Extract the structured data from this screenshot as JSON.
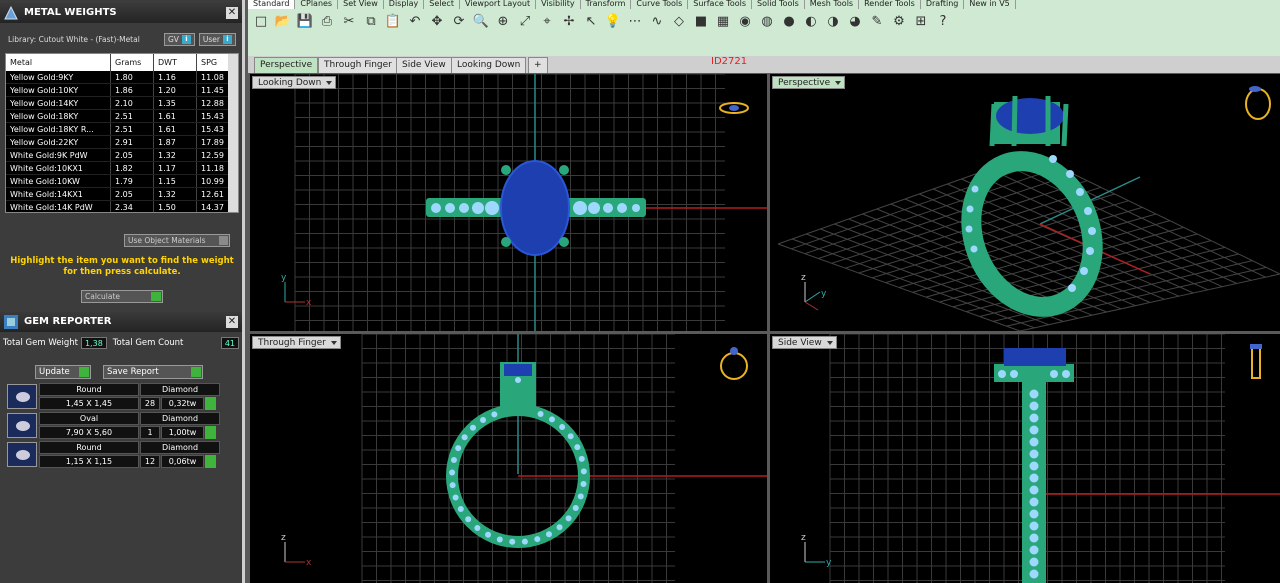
{
  "metal_panel": {
    "title": "METAL WEIGHTS",
    "library_label": "Library: Cutout White - (Fast)-Metal",
    "btn_gv": "GV",
    "btn_user": "User",
    "columns": [
      "Metal",
      "Grams",
      "DWT",
      "SPG"
    ],
    "rows": [
      [
        "Yellow Gold:9KY",
        "1.80",
        "1.16",
        "11.08"
      ],
      [
        "Yellow Gold:10KY",
        "1.86",
        "1.20",
        "11.45"
      ],
      [
        "Yellow Gold:14KY",
        "2.10",
        "1.35",
        "12.88"
      ],
      [
        "Yellow Gold:18KY",
        "2.51",
        "1.61",
        "15.43"
      ],
      [
        "Yellow Gold:18KY R...",
        "2.51",
        "1.61",
        "15.43"
      ],
      [
        "Yellow Gold:22KY",
        "2.91",
        "1.87",
        "17.89"
      ],
      [
        "White Gold:9K PdW",
        "2.05",
        "1.32",
        "12.59"
      ],
      [
        "White Gold:10KX1",
        "1.82",
        "1.17",
        "11.18"
      ],
      [
        "White Gold:10KW",
        "1.79",
        "1.15",
        "10.99"
      ],
      [
        "White Gold:14KX1",
        "2.05",
        "1.32",
        "12.61"
      ],
      [
        "White Gold:14K PdW",
        "2.34",
        "1.50",
        "14.37"
      ]
    ],
    "use_object_materials": "Use Object Materials",
    "hint": "Highlight the item you want to find the weight for then press calculate.",
    "calculate": "Calculate"
  },
  "gem_panel": {
    "title": "GEM REPORTER",
    "total_weight_label": "Total Gem Weight",
    "total_weight": "1,38",
    "total_count_label": "Total Gem Count",
    "total_count": "41",
    "update": "Update",
    "save_report": "Save Report",
    "gems": [
      {
        "shape": "Round",
        "type": "Diamond",
        "size": "1,45 X 1,45",
        "count": "28",
        "weight": "0,32tw"
      },
      {
        "shape": "Oval",
        "type": "Diamond",
        "size": "7,90 X 5,60",
        "count": "1",
        "weight": "1,00tw"
      },
      {
        "shape": "Round",
        "type": "Diamond",
        "size": "1,15 X 1,15",
        "count": "12",
        "weight": "0,06tw"
      }
    ]
  },
  "toolbar": {
    "tabs": [
      "Standard",
      "CPlanes",
      "Set View",
      "Display",
      "Select",
      "Viewport Layout",
      "Visibility",
      "Transform",
      "Curve Tools",
      "Surface Tools",
      "Solid Tools",
      "Mesh Tools",
      "Render Tools",
      "Drafting",
      "New in V5"
    ],
    "icons": [
      "new-file-icon",
      "open-folder-icon",
      "save-icon",
      "print-icon",
      "cut-icon",
      "copy-icon",
      "paste-icon",
      "undo-icon",
      "pan-icon",
      "rotate-icon",
      "zoom-icon",
      "zoom-window-icon",
      "zoom-extents-icon",
      "zoom-selected-icon",
      "move-icon",
      "select-icon",
      "light-icon",
      "points-icon",
      "curve-icon",
      "surface-icon",
      "solid-icon",
      "mesh-icon",
      "render-icon",
      "color-wheel-icon",
      "sphere-icon",
      "sphere-shaded-icon",
      "sphere-rendered-icon",
      "sphere-blue-icon",
      "pencil-icon",
      "options-icon",
      "grid-snap-icon",
      "help-icon"
    ]
  },
  "viewport_tabs": [
    "Perspective",
    "Through Finger",
    "Side View",
    "Looking Down",
    "+"
  ],
  "doc_id": "ID2721",
  "viewports": {
    "looking_down": "Looking Down",
    "perspective": "Perspective",
    "through_finger": "Through Finger",
    "side_view": "Side View"
  },
  "colors": {
    "ring_green": "#2aa77a",
    "stone_blue": "#1e3fb0",
    "grid": "#3a3a3a",
    "x_axis": "#b02020",
    "y_axis": "#2a8a8a",
    "accent_yellow": "#ffd400"
  }
}
